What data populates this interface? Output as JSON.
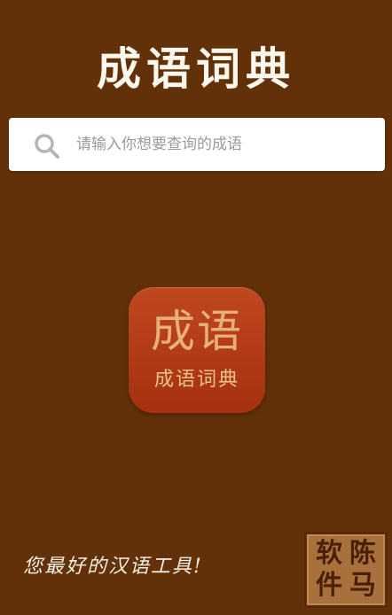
{
  "header": {
    "title": "成语词典"
  },
  "search": {
    "placeholder": "请输入你想要查询的成语",
    "value": ""
  },
  "logo": {
    "main_text": "成语",
    "sub_text": "成语词典"
  },
  "footer": {
    "tagline": "您最好的汉语工具!",
    "seal": {
      "chars": [
        "软",
        "陈",
        "件",
        "马"
      ]
    }
  },
  "colors": {
    "background": "#623109",
    "logo_red": "#b33c17",
    "seal_tan": "#a8703a",
    "title_text": "#fdf8ee"
  },
  "icons": {
    "search": "search-icon"
  }
}
